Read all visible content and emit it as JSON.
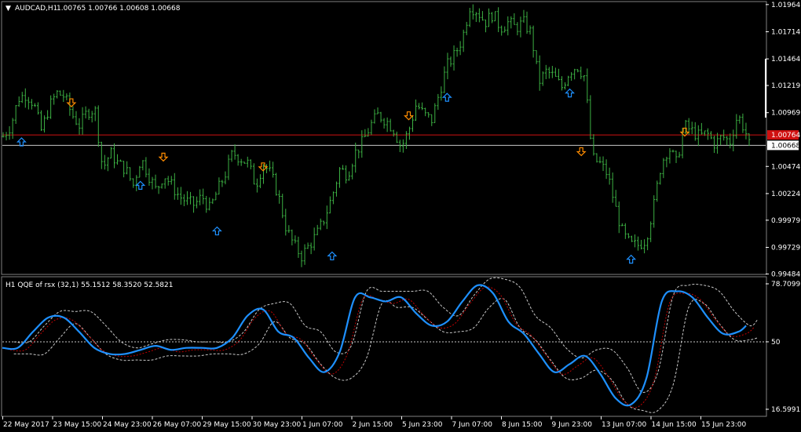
{
  "chart_data": [
    {
      "type": "bar",
      "title": "AUDCAD,H1",
      "ohlc_text": "1.00765 1.00766 1.00608 1.00668",
      "ylim": [
        0.9948,
        1.0197
      ],
      "y_ticks": [
        "1.01964",
        "1.01714",
        "1.01464",
        "1.01219",
        "1.00969",
        "1.00474",
        "1.00224",
        "0.99979",
        "0.99729",
        "0.99484"
      ],
      "last_price": "1.00668",
      "red_line_price": "1.00764",
      "grid": false,
      "close_path": [
        [
          0,
          1.0075
        ],
        [
          2,
          1.0085
        ],
        [
          4,
          1.011
        ],
        [
          6,
          1.0114
        ],
        [
          8,
          1.0105
        ],
        [
          10,
          1.008
        ],
        [
          12,
          1.0102
        ],
        [
          14,
          1.0115
        ],
        [
          16,
          1.0112
        ],
        [
          18,
          1.0095
        ],
        [
          20,
          1.0085
        ],
        [
          22,
          1.0098
        ],
        [
          24,
          1.01
        ],
        [
          26,
          1.0045
        ],
        [
          28,
          1.006
        ],
        [
          30,
          1.005
        ],
        [
          32,
          1.0045
        ],
        [
          34,
          1.003
        ],
        [
          36,
          1.0055
        ],
        [
          38,
          1.004
        ],
        [
          40,
          1.0025
        ],
        [
          42,
          1.004
        ],
        [
          44,
          1.003
        ],
        [
          46,
          1.002
        ],
        [
          48,
          1.0015
        ],
        [
          50,
          1.0012
        ],
        [
          52,
          1.002
        ],
        [
          54,
          1.0008
        ],
        [
          56,
          1.0025
        ],
        [
          58,
          1.004
        ],
        [
          60,
          1.006
        ],
        [
          62,
          1.0055
        ],
        [
          64,
          1.005
        ],
        [
          66,
          1.003
        ],
        [
          68,
          1.005
        ],
        [
          70,
          1.004
        ],
        [
          72,
          1.002
        ],
        [
          74,
          0.999
        ],
        [
          76,
          0.9975
        ],
        [
          78,
          0.9965
        ],
        [
          80,
          0.9975
        ],
        [
          82,
          0.9985
        ],
        [
          84,
          1.0
        ],
        [
          86,
          1.002
        ],
        [
          88,
          1.0045
        ],
        [
          90,
          1.004
        ],
        [
          92,
          1.006
        ],
        [
          94,
          1.007
        ],
        [
          96,
          1.0085
        ],
        [
          98,
          1.0095
        ],
        [
          100,
          1.009
        ],
        [
          102,
          1.0082
        ],
        [
          104,
          1.0065
        ],
        [
          106,
          1.008
        ],
        [
          108,
          1.0105
        ],
        [
          110,
          1.0095
        ],
        [
          112,
          1.009
        ],
        [
          114,
          1.0115
        ],
        [
          116,
          1.014
        ],
        [
          118,
          1.015
        ],
        [
          120,
          1.0165
        ],
        [
          122,
          1.0195
        ],
        [
          124,
          1.019
        ],
        [
          126,
          1.018
        ],
        [
          128,
          1.0188
        ],
        [
          130,
          1.0175
        ],
        [
          132,
          1.018
        ],
        [
          134,
          1.0175
        ],
        [
          136,
          1.018
        ],
        [
          138,
          1.017
        ],
        [
          140,
          1.0125
        ],
        [
          142,
          1.0135
        ],
        [
          144,
          1.013
        ],
        [
          146,
          1.012
        ],
        [
          148,
          1.0135
        ],
        [
          150,
          1.014
        ],
        [
          152,
          1.013
        ],
        [
          154,
          1.0055
        ],
        [
          156,
          1.005
        ],
        [
          158,
          1.004
        ],
        [
          160,
          1.001
        ],
        [
          162,
          0.9985
        ],
        [
          164,
          0.9975
        ],
        [
          166,
          0.9975
        ],
        [
          168,
          0.998
        ],
        [
          170,
          1.001
        ],
        [
          172,
          1.005
        ],
        [
          174,
          1.0065
        ],
        [
          176,
          1.005
        ],
        [
          178,
          1.0085
        ],
        [
          180,
          1.008
        ],
        [
          182,
          1.0075
        ],
        [
          184,
          1.0078
        ],
        [
          186,
          1.0068
        ],
        [
          188,
          1.0075
        ],
        [
          190,
          1.007
        ],
        [
          192,
          1.0095
        ],
        [
          194,
          1.008
        ],
        [
          195,
          1.0067
        ]
      ],
      "down_arrows": [
        [
          18,
          1.0106
        ],
        [
          42,
          1.0056
        ],
        [
          68,
          1.0047
        ],
        [
          106,
          1.0094
        ],
        [
          151,
          1.0061
        ],
        [
          178,
          1.0079
        ]
      ],
      "up_arrows": [
        [
          5,
          1.007
        ],
        [
          36,
          1.003
        ],
        [
          56,
          0.9988
        ],
        [
          86,
          0.9965
        ],
        [
          116,
          1.0111
        ],
        [
          148,
          1.0115
        ],
        [
          164,
          0.9962
        ]
      ]
    },
    {
      "type": "line",
      "title": "H1 QQE of rsx (32,1) 55.1512 58.3520 52.5821",
      "ylim": [
        16.5991,
        78.7099
      ],
      "y_ticks": [
        "78.7099",
        "50",
        "16.5991"
      ],
      "level_line": 50,
      "series": [
        {
          "color": "#1e90ff",
          "values": [
            [
              0,
              47
            ],
            [
              4,
              47
            ],
            [
              8,
              55
            ],
            [
              12,
              62
            ],
            [
              16,
              62
            ],
            [
              20,
              55
            ],
            [
              24,
              47
            ],
            [
              28,
              44
            ],
            [
              32,
              44
            ],
            [
              36,
              46
            ],
            [
              40,
              48
            ],
            [
              44,
              46
            ],
            [
              48,
              47
            ],
            [
              52,
              47
            ],
            [
              56,
              47
            ],
            [
              60,
              52
            ],
            [
              64,
              63
            ],
            [
              68,
              66
            ],
            [
              72,
              55
            ],
            [
              76,
              52
            ],
            [
              80,
              42
            ],
            [
              84,
              35
            ],
            [
              88,
              45
            ],
            [
              92,
              72
            ],
            [
              96,
              72
            ],
            [
              100,
              70
            ],
            [
              104,
              72
            ],
            [
              108,
              64
            ],
            [
              112,
              58
            ],
            [
              116,
              60
            ],
            [
              120,
              70
            ],
            [
              124,
              78
            ],
            [
              128,
              74
            ],
            [
              132,
              60
            ],
            [
              136,
              54
            ],
            [
              140,
              44
            ],
            [
              144,
              35
            ],
            [
              148,
              39
            ],
            [
              152,
              43
            ],
            [
              156,
              34
            ],
            [
              160,
              22
            ],
            [
              164,
              19
            ],
            [
              168,
              32
            ],
            [
              172,
              70
            ],
            [
              176,
              75
            ],
            [
              180,
              72
            ],
            [
              184,
              62
            ],
            [
              188,
              54
            ],
            [
              192,
              55
            ],
            [
              194,
              58
            ]
          ]
        }
      ]
    }
  ],
  "x_labels": [
    "22 May 2017",
    "23 May 15:00",
    "24 May 23:00",
    "26 May 07:00",
    "29 May 15:00",
    "30 May 23:00",
    "1 Jun 07:00",
    "2 Jun 15:00",
    "5 Jun 23:00",
    "7 Jun 07:00",
    "8 Jun 15:00",
    "9 Jun 23:00",
    "13 Jun 07:00",
    "14 Jun 15:00",
    "15 Jun 23:00"
  ],
  "colors": {
    "background": "#000000",
    "price_bars": "#3cb043",
    "qqe_main": "#1e90ff",
    "qqe_dash": "#c8c8c8",
    "qqe_red": "#c00000",
    "down_arrow": "#ff8c00",
    "up_arrow": "#1e90ff",
    "red_line": "#d01010",
    "last_price_line": "#c8c8c8"
  }
}
